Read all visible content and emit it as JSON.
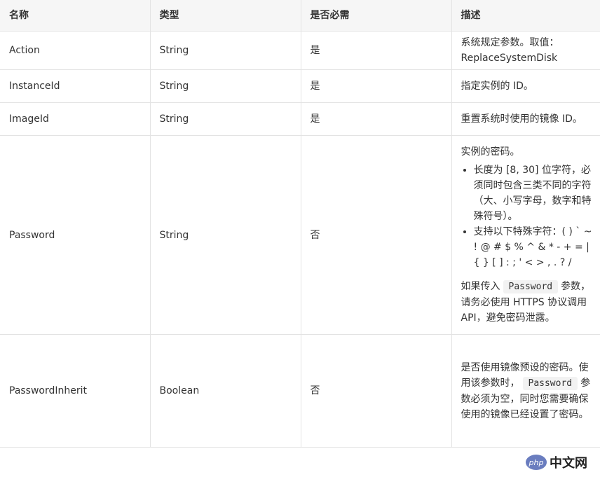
{
  "table": {
    "headers": [
      "名称",
      "类型",
      "是否必需",
      "描述"
    ],
    "rows": {
      "action": {
        "name": "Action",
        "type": "String",
        "required": "是",
        "desc_l1": "系统规定参数。取值：",
        "desc_l2": "ReplaceSystemDisk"
      },
      "instance": {
        "name": "InstanceId",
        "type": "String",
        "required": "是",
        "desc": "指定实例的 ID。"
      },
      "image": {
        "name": "ImageId",
        "type": "String",
        "required": "是",
        "desc": "重置系统时使用的镜像 ID。"
      },
      "password": {
        "name": "Password",
        "type": "String",
        "required": "否",
        "desc_intro": "实例的密码。",
        "bullet1": "长度为 [8, 30] 位字符，必须同时包含三类不同的字符（大、小写字母，数字和特殊符号）。",
        "bullet2": "支持以下特殊字符：( ) ` ~ ! @ # $ % ^ & * - + = | { } [ ] : ; ' < > , . ? /",
        "note_before": "如果传入",
        "note_code": "Password",
        "note_after": "参数，请务必使用 HTTPS 协议调用 API，避免密码泄露。"
      },
      "inherit": {
        "name": "PasswordInherit",
        "type": "Boolean",
        "required": "否",
        "desc_before": "是否使用镜像预设的密码。使用该参数时，",
        "desc_code": "Password",
        "desc_after": "参数必须为空，同时您需要确保使用的镜像已经设置了密码。"
      }
    }
  },
  "watermark": {
    "badge": "php",
    "text": "中文网"
  }
}
